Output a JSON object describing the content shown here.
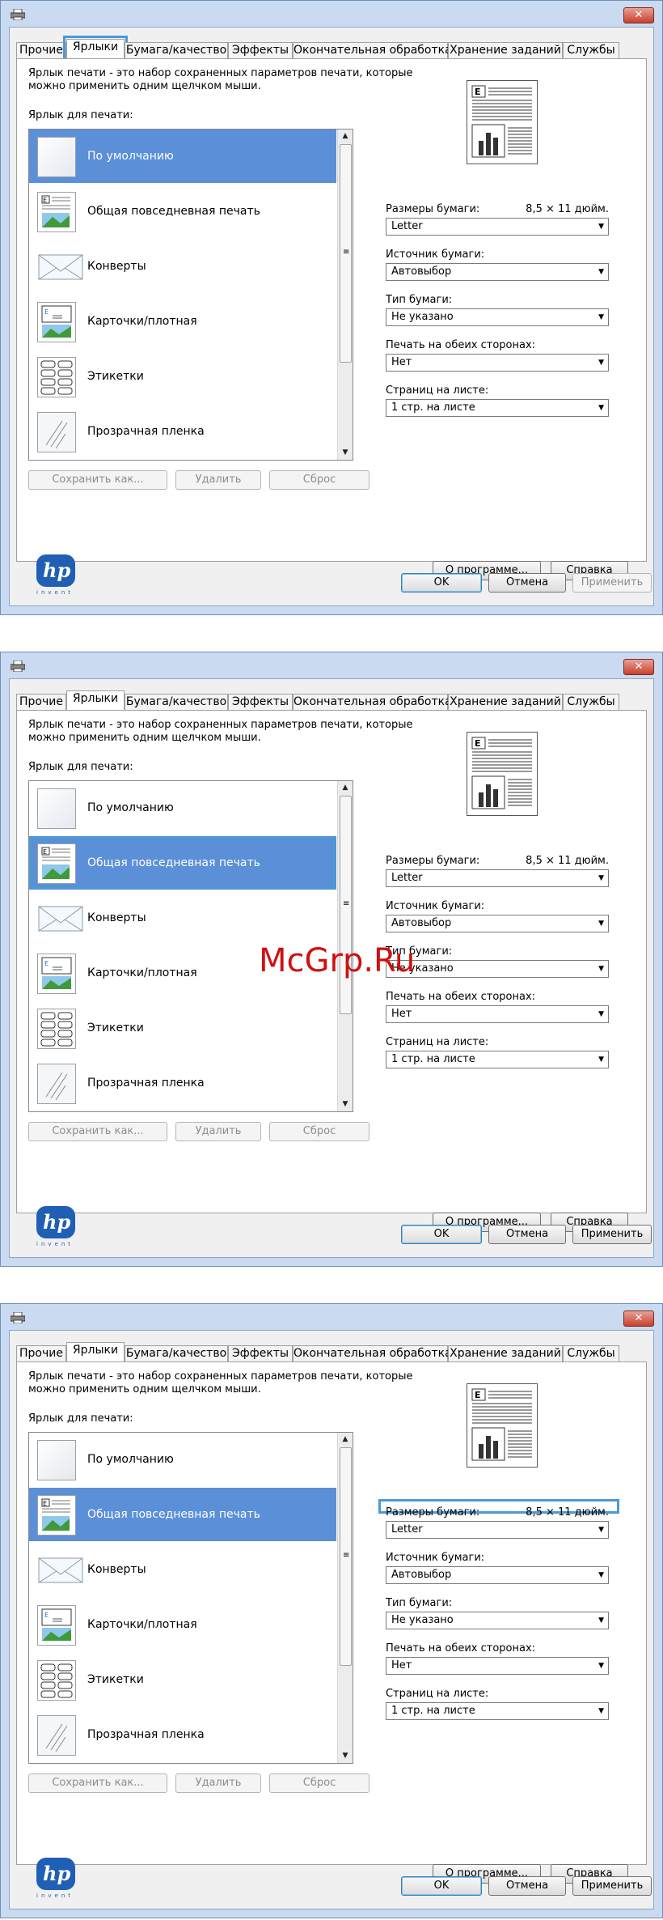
{
  "tabs": [
    "Прочие",
    "Ярлыки",
    "Бумага/качество",
    "Эффекты",
    "Окончательная обработка",
    "Хранение заданий",
    "Службы"
  ],
  "description": "Ярлык печати - это набор сохраненных параметров печати, которые можно применить одним щелчком мыши.",
  "list_label": "Ярлык для печати:",
  "shortcuts": [
    {
      "label": "По умолчанию",
      "icon": "blank-page-icon"
    },
    {
      "label": "Общая повседневная печать",
      "icon": "document-image-icon"
    },
    {
      "label": "Конверты",
      "icon": "envelope-icon"
    },
    {
      "label": "Карточки/плотная",
      "icon": "card-icon"
    },
    {
      "label": "Этикетки",
      "icon": "labels-icon"
    },
    {
      "label": "Прозрачная пленка",
      "icon": "transparency-icon"
    }
  ],
  "list_buttons": {
    "save_as": "Сохранить как...",
    "delete": "Удалить",
    "reset": "Сброс"
  },
  "settings": {
    "paper_size_label": "Размеры бумаги:",
    "paper_size_value": "8,5 × 11 дюйм.",
    "paper_size_select": "Letter",
    "source_label": "Источник бумаги:",
    "source_select": "Автовыбор",
    "type_label": "Тип бумаги:",
    "type_select": "Не указано",
    "duplex_label": "Печать на обеих сторонах:",
    "duplex_select": "Нет",
    "pages_label": "Страниц на листе:",
    "pages_select": "1 стр. на листе"
  },
  "about_button": "О программе...",
  "help_button": "Справка",
  "ok_button": "OK",
  "cancel_button": "Отмена",
  "apply_button": "Применить",
  "logo_text": "hp",
  "logo_sub": "invent",
  "watermark": "McGrp.Ru",
  "colors": {
    "selection": "#5b8fd8",
    "highlight": "#4a9ad6",
    "title_bg": "#c9daf1"
  }
}
